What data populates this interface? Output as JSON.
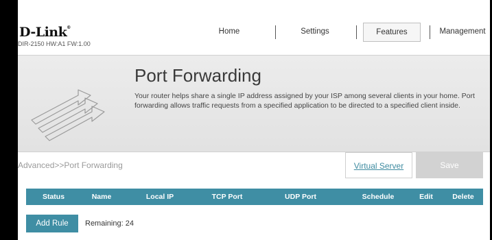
{
  "header": {
    "logo_text": "D-Link",
    "model_info": "DIR-2150 HW:A1 FW:1.00",
    "nav": [
      {
        "label": "Home"
      },
      {
        "label": "Settings"
      },
      {
        "label": "Features",
        "active": true
      },
      {
        "label": "Management"
      }
    ]
  },
  "banner": {
    "title": "Port Forwarding",
    "description": "Your router helps share a single IP address assigned by your ISP among several clients in your home. Port forwarding allows traffic requests from a specified application to be directed to a specified client inside."
  },
  "breadcrumb": "Advanced>>Port Forwarding",
  "actions": {
    "virtual_server": "Virtual Server",
    "save": "Save"
  },
  "table": {
    "columns": [
      "Status",
      "Name",
      "Local IP",
      "TCP Port",
      "UDP Port",
      "Schedule",
      "Edit",
      "Delete"
    ],
    "rows": []
  },
  "footer": {
    "add_rule": "Add Rule",
    "remaining": "Remaining: 24"
  },
  "colors": {
    "accent": "#3f8ea4",
    "save_disabled": "#d2d2d2",
    "link": "#3e8ba0"
  }
}
